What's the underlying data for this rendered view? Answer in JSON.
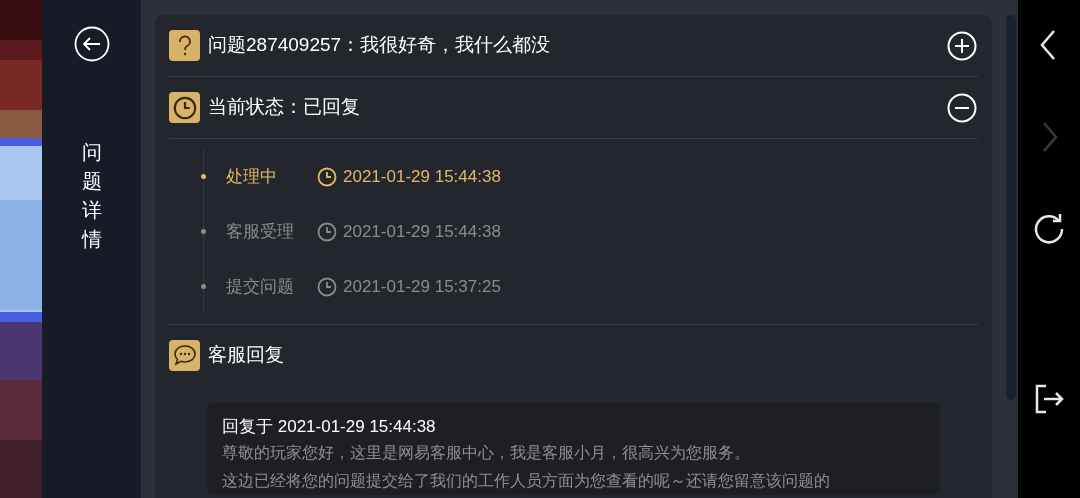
{
  "sidebar": {
    "title": "问题详情"
  },
  "question": {
    "title": "问题287409257：我很好奇，我什么都没",
    "expanded": false
  },
  "status": {
    "title": "当前状态：已回复",
    "expanded": true,
    "timeline": [
      {
        "label": "处理中",
        "time": "2021-01-29 15:44:38",
        "selected": true
      },
      {
        "label": "客服受理",
        "time": "2021-01-29 15:44:38",
        "selected": false
      },
      {
        "label": "提交问题",
        "time": "2021-01-29 15:37:25",
        "selected": false
      }
    ]
  },
  "reply": {
    "title": "客服回复",
    "heading": "回复于 2021-01-29 15:44:38",
    "lines": [
      "尊敬的玩家您好，这里是网易客服中心，我是客服小月，很高兴为您服务。",
      "这边已经将您的问题提交给了我们的工作人员方面为您查看的呢～还请您留意该问题的"
    ]
  },
  "nav": [
    {
      "kind": "back",
      "disabled": false
    },
    {
      "kind": "forward",
      "disabled": true
    },
    {
      "kind": "refresh",
      "disabled": false
    },
    {
      "kind": "exit",
      "disabled": false
    }
  ]
}
